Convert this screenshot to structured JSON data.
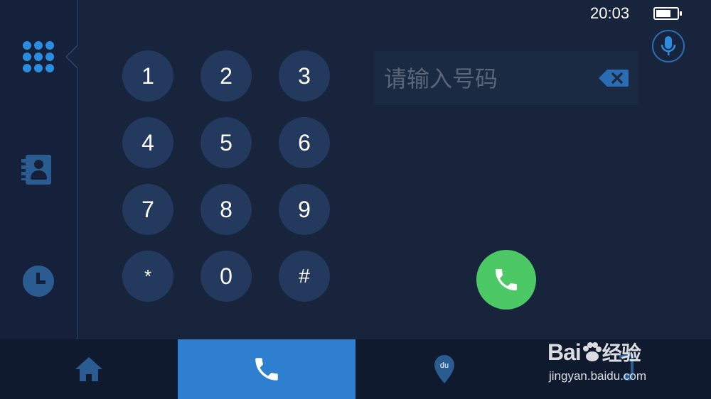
{
  "status": {
    "time": "20:03"
  },
  "sidebar": {
    "items": [
      {
        "name": "dialpad",
        "icon": "dialpad-icon",
        "active": true
      },
      {
        "name": "contacts",
        "icon": "contacts-book-icon",
        "active": false
      },
      {
        "name": "recents",
        "icon": "clock-icon",
        "active": false
      }
    ]
  },
  "keypad": {
    "keys": [
      "1",
      "2",
      "3",
      "4",
      "5",
      "6",
      "7",
      "8",
      "9",
      "*",
      "0",
      "#"
    ]
  },
  "input": {
    "placeholder": "请输入号码",
    "value": ""
  },
  "colors": {
    "background": "#17243b",
    "key": "#233a5e",
    "accent": "#2f7fd0",
    "call": "#4cc864"
  },
  "bottom_tabs": [
    {
      "name": "home",
      "icon": "home-icon",
      "active": false
    },
    {
      "name": "phone",
      "icon": "phone-icon",
      "active": true
    },
    {
      "name": "navigation",
      "icon": "map-pin-icon",
      "label": "du",
      "active": false
    },
    {
      "name": "music",
      "icon": "music-note-icon",
      "active": false
    }
  ],
  "watermark": {
    "logo_text": "Bai",
    "logo_text_2": "经验",
    "url": "jingyan.baidu.com"
  }
}
